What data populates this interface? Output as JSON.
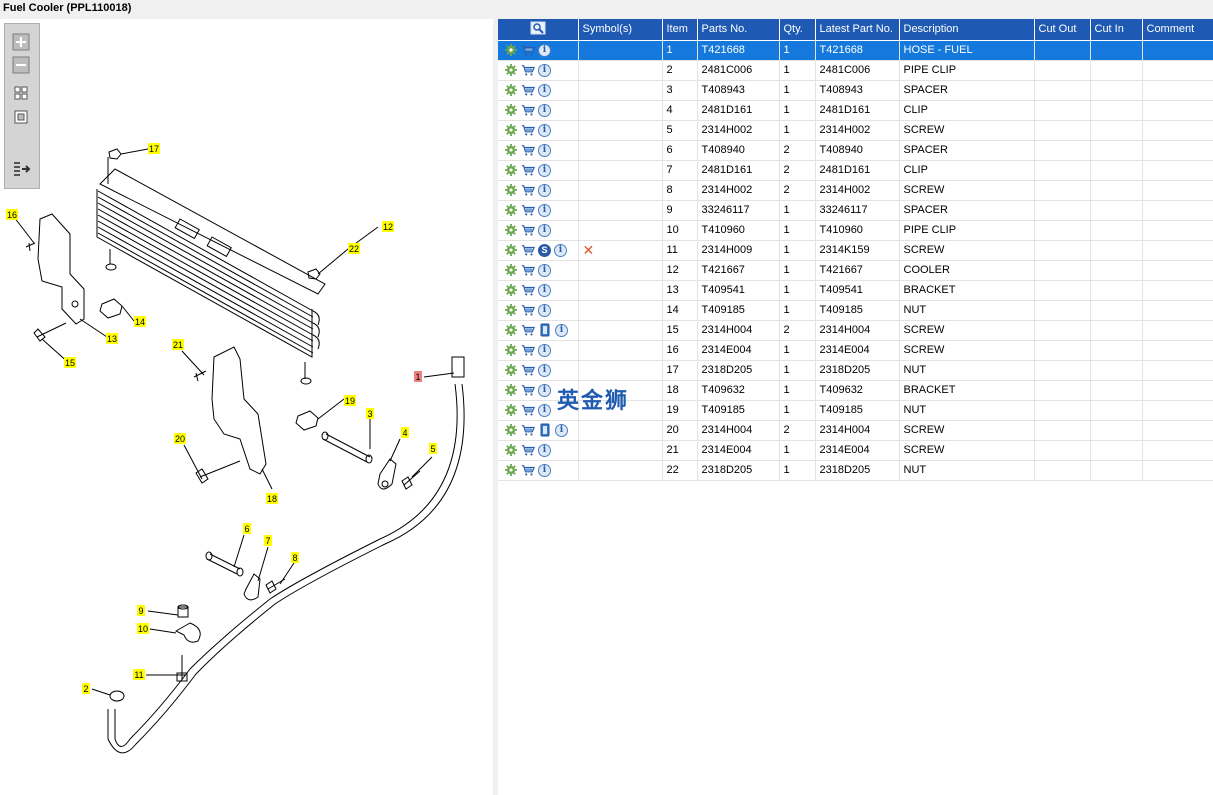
{
  "window": {
    "title": "Fuel Cooler (PPL110018)"
  },
  "watermark": "英金狮",
  "toolbar": {
    "zoom_in": "zoom-in-icon",
    "zoom_out": "zoom-out-icon",
    "fit": "fit-all-icon",
    "actual": "actual-size-icon",
    "export": "export-icon"
  },
  "columns": [
    "",
    "Symbol(s)",
    "Item",
    "Parts No.",
    "Qty.",
    "Latest Part No.",
    "Description",
    "Cut Out",
    "Cut In",
    "Comment"
  ],
  "rows": [
    {
      "item": "1",
      "part": "T421668",
      "qty": "1",
      "latest": "T421668",
      "desc": "HOSE - FUEL",
      "extra": "",
      "selected": true
    },
    {
      "item": "2",
      "part": "2481C006",
      "qty": "1",
      "latest": "2481C006",
      "desc": "PIPE CLIP",
      "extra": ""
    },
    {
      "item": "3",
      "part": "T408943",
      "qty": "1",
      "latest": "T408943",
      "desc": "SPACER",
      "extra": ""
    },
    {
      "item": "4",
      "part": "2481D161",
      "qty": "1",
      "latest": "2481D161",
      "desc": "CLIP",
      "extra": ""
    },
    {
      "item": "5",
      "part": "2314H002",
      "qty": "1",
      "latest": "2314H002",
      "desc": "SCREW",
      "extra": ""
    },
    {
      "item": "6",
      "part": "T408940",
      "qty": "2",
      "latest": "T408940",
      "desc": "SPACER",
      "extra": ""
    },
    {
      "item": "7",
      "part": "2481D161",
      "qty": "2",
      "latest": "2481D161",
      "desc": "CLIP",
      "extra": ""
    },
    {
      "item": "8",
      "part": "2314H002",
      "qty": "2",
      "latest": "2314H002",
      "desc": "SCREW",
      "extra": ""
    },
    {
      "item": "9",
      "part": "33246117",
      "qty": "1",
      "latest": "33246117",
      "desc": "SPACER",
      "extra": ""
    },
    {
      "item": "10",
      "part": "T410960",
      "qty": "1",
      "latest": "T410960",
      "desc": "PIPE CLIP",
      "extra": ""
    },
    {
      "item": "11",
      "part": "2314H009",
      "qty": "1",
      "latest": "2314K159",
      "desc": "SCREW",
      "extra": "s"
    },
    {
      "item": "12",
      "part": "T421667",
      "qty": "1",
      "latest": "T421667",
      "desc": "COOLER",
      "extra": ""
    },
    {
      "item": "13",
      "part": "T409541",
      "qty": "1",
      "latest": "T409541",
      "desc": "BRACKET",
      "extra": ""
    },
    {
      "item": "14",
      "part": "T409185",
      "qty": "1",
      "latest": "T409185",
      "desc": "NUT",
      "extra": ""
    },
    {
      "item": "15",
      "part": "2314H004",
      "qty": "2",
      "latest": "2314H004",
      "desc": "SCREW",
      "extra": "doc"
    },
    {
      "item": "16",
      "part": "2314E004",
      "qty": "1",
      "latest": "2314E004",
      "desc": "SCREW",
      "extra": ""
    },
    {
      "item": "17",
      "part": "2318D205",
      "qty": "1",
      "latest": "2318D205",
      "desc": "NUT",
      "extra": ""
    },
    {
      "item": "18",
      "part": "T409632",
      "qty": "1",
      "latest": "T409632",
      "desc": "BRACKET",
      "extra": ""
    },
    {
      "item": "19",
      "part": "T409185",
      "qty": "1",
      "latest": "T409185",
      "desc": "NUT",
      "extra": ""
    },
    {
      "item": "20",
      "part": "2314H004",
      "qty": "2",
      "latest": "2314H004",
      "desc": "SCREW",
      "extra": "doc"
    },
    {
      "item": "21",
      "part": "2314E004",
      "qty": "1",
      "latest": "2314E004",
      "desc": "SCREW",
      "extra": ""
    },
    {
      "item": "22",
      "part": "2318D205",
      "qty": "1",
      "latest": "2318D205",
      "desc": "NUT",
      "extra": ""
    }
  ],
  "callouts": [
    {
      "label": "17"
    },
    {
      "label": "16"
    },
    {
      "label": "12"
    },
    {
      "label": "22"
    },
    {
      "label": "14"
    },
    {
      "label": "13"
    },
    {
      "label": "15"
    },
    {
      "label": "21"
    },
    {
      "label": "1"
    },
    {
      "label": "19"
    },
    {
      "label": "3"
    },
    {
      "label": "4"
    },
    {
      "label": "5"
    },
    {
      "label": "20"
    },
    {
      "label": "18"
    },
    {
      "label": "6"
    },
    {
      "label": "7"
    },
    {
      "label": "8"
    },
    {
      "label": "9"
    },
    {
      "label": "10"
    },
    {
      "label": "11"
    },
    {
      "label": "2"
    }
  ],
  "colors": {
    "header": "#1e5ab4",
    "selected_row": "#1478dc",
    "callout": "#ffff00",
    "callout_selected": "#f08080"
  }
}
